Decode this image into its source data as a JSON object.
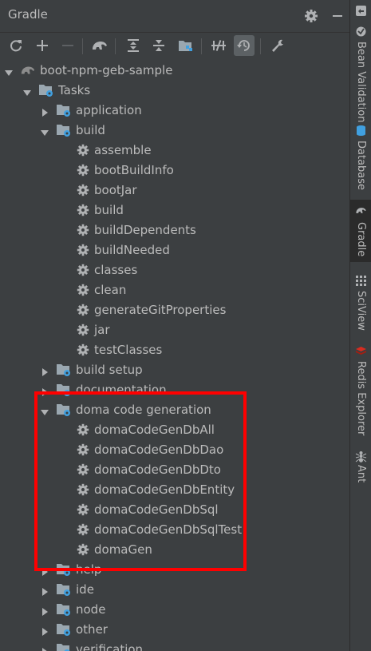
{
  "panel": {
    "title": "Gradle",
    "icons": [
      "gear-icon",
      "minimize-icon"
    ]
  },
  "toolbar": {
    "buttons": [
      "refresh-icon",
      "add-icon",
      "remove-icon",
      "elephant-icon",
      "expand-all-icon",
      "collapse-all-icon",
      "dependencies-icon",
      "toggle-offline-icon",
      "history-icon",
      "wrench-icon"
    ]
  },
  "tree": {
    "root": "boot-npm-geb-sample",
    "tasks": "Tasks",
    "application": "application",
    "build": "build",
    "build_tasks": [
      "assemble",
      "bootBuildInfo",
      "bootJar",
      "build",
      "buildDependents",
      "buildNeeded",
      "classes",
      "clean",
      "generateGitProperties",
      "jar",
      "testClasses"
    ],
    "build_setup": "build setup",
    "documentation": "documentation",
    "doma": "doma code generation",
    "doma_tasks": [
      "domaCodeGenDbAll",
      "domaCodeGenDbDao",
      "domaCodeGenDbDto",
      "domaCodeGenDbEntity",
      "domaCodeGenDbSql",
      "domaCodeGenDbSqlTest",
      "domaGen"
    ],
    "help": "help",
    "ide": "ide",
    "node": "node",
    "other": "other",
    "verification": "verification"
  },
  "sidebar": {
    "bean_validation": "Bean Validation",
    "database": "Database",
    "gradle": "Gradle",
    "sciview": "SciView",
    "redis": "Redis Explorer",
    "ant": "Ant"
  },
  "colors": {
    "background": "#3c3f41",
    "text": "#bbbbbb",
    "highlight": "#ff0000",
    "folder_badge": "#40a0e0"
  }
}
